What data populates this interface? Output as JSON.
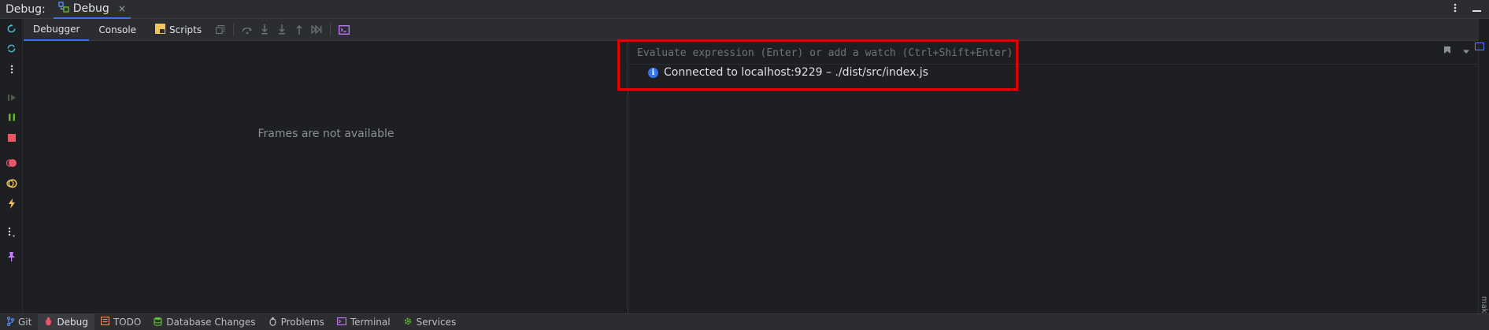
{
  "window": {
    "panel_label": "Debug:",
    "tab_label": "Debug",
    "tab_close": "×"
  },
  "toolbar": {
    "tabs": [
      {
        "label": "Debugger"
      },
      {
        "label": "Console"
      },
      {
        "label": "Scripts"
      }
    ]
  },
  "frames": {
    "empty_message": "Frames are not available"
  },
  "evaluate": {
    "placeholder": "Evaluate expression (Enter) or add a watch (Ctrl+Shift+Enter)",
    "value": ""
  },
  "console": {
    "info_icon": "i",
    "message": "Connected to localhost:9229 – ./dist/src/index.js"
  },
  "right_strip": {
    "label": "make"
  },
  "bottom_tools": [
    {
      "label": "Git",
      "icon": "git-branch-icon"
    },
    {
      "label": "Debug",
      "icon": "bug-icon"
    },
    {
      "label": "TODO",
      "icon": "list-icon"
    },
    {
      "label": "Database Changes",
      "icon": "database-icon"
    },
    {
      "label": "Problems",
      "icon": "problems-icon"
    },
    {
      "label": "Terminal",
      "icon": "terminal-icon"
    },
    {
      "label": "Services",
      "icon": "gear-icon"
    }
  ],
  "colors": {
    "accent": "#3574f0",
    "stop": "#e55765",
    "resume": "#5fb832",
    "highlight_box": "#e00000",
    "warning": "#f2c55c"
  }
}
